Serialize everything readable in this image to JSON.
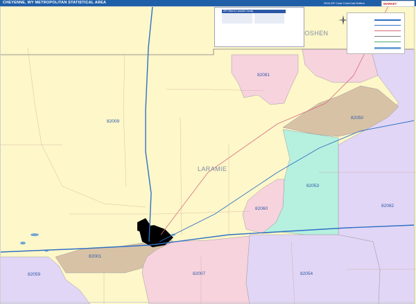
{
  "header": {
    "title": "CHEYENNE, WY METROPOLITAN STATISTICAL AREA",
    "edition": "2026 ZIP Code ColorCast Edition",
    "brand_line1": "MARKET",
    "brand_line2": "MAPS"
  },
  "counties": [
    {
      "name": "LARAMIE"
    },
    {
      "name": "GOSHEN"
    }
  ],
  "zip_codes": [
    {
      "zip": "82009",
      "color": "#fdf7c9"
    },
    {
      "zip": "82081",
      "color": "#f7d3de"
    },
    {
      "zip": "82050",
      "color": "#d8c2a6"
    },
    {
      "zip": "82053",
      "color": "#b6f0df"
    },
    {
      "zip": "82060",
      "color": "#f7d3de"
    },
    {
      "zip": "82082",
      "color": "#e1d6f5"
    },
    {
      "zip": "82001",
      "color": "#d8c2a6"
    },
    {
      "zip": "82007",
      "color": "#f7d3de"
    },
    {
      "zip": "82054",
      "color": "#e1d6f5"
    },
    {
      "zip": "82059",
      "color": "#e1d6f5"
    }
  ],
  "inset": {
    "header": "ZIP  Cities in Laramie County"
  },
  "colors": {
    "title_bar": "#1f5fa8",
    "water": "#6fa4d8",
    "highway": "#2f6fc4",
    "road_red": "#d66a7d",
    "county_border": "#7a7a7a",
    "inset_bg": "#ffffff"
  },
  "icons": [
    "compass-icon",
    "market-maps-logo"
  ]
}
